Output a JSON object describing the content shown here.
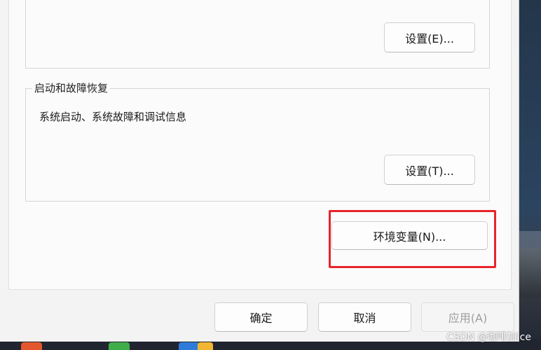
{
  "system_properties": {
    "top_group": {
      "settings_button": "设置(E)..."
    },
    "startup_recovery": {
      "title": "启动和故障恢复",
      "description": "系统启动、系统故障和调试信息",
      "settings_button": "设置(T)..."
    },
    "env_vars_button": "环境变量(N)..."
  },
  "footer": {
    "ok": "确定",
    "cancel": "取消",
    "apply": "应用(A)"
  },
  "annotation": {
    "highlight_color": "#e8242b"
  },
  "watermark": "CSDN @咖啡加Ice"
}
